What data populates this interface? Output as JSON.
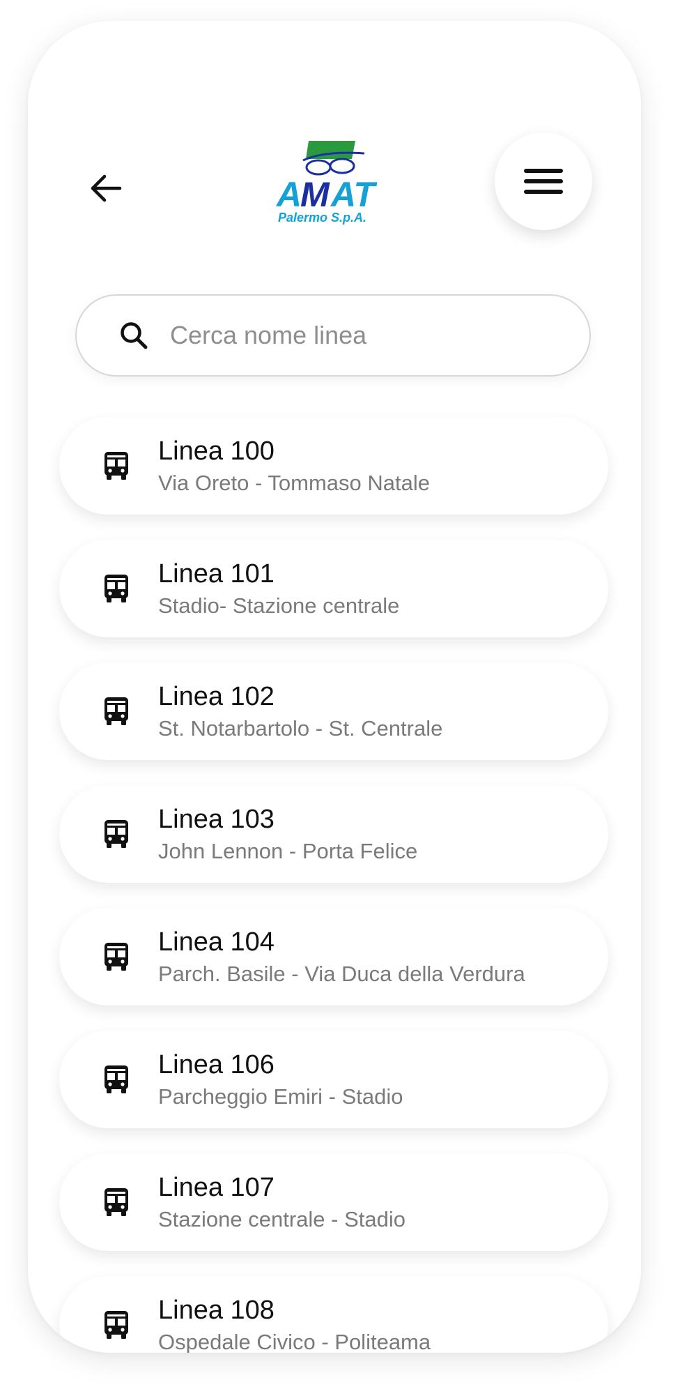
{
  "header": {
    "back_icon": "arrow-left-icon",
    "logo": {
      "brand_text": "AMAT",
      "sub_text": "Palermo S.p.A.",
      "colors": {
        "blue": "#1b2fa3",
        "cyan": "#13a1d6",
        "green": "#2b9a3f"
      }
    },
    "menu_icon": "hamburger-menu-icon"
  },
  "search": {
    "icon": "search-icon",
    "placeholder": "Cerca nome linea",
    "value": ""
  },
  "lines": [
    {
      "title": "Linea 100",
      "route": "Via Oreto - Tommaso Natale",
      "icon": "bus-icon"
    },
    {
      "title": "Linea 101",
      "route": "Stadio- Stazione centrale",
      "icon": "bus-icon"
    },
    {
      "title": "Linea 102",
      "route": "St. Notarbartolo - St. Centrale",
      "icon": "bus-icon"
    },
    {
      "title": "Linea 103",
      "route": "John Lennon - Porta Felice",
      "icon": "bus-icon"
    },
    {
      "title": "Linea 104",
      "route": "Parch. Basile - Via Duca della Verdura",
      "icon": "bus-icon"
    },
    {
      "title": "Linea 106",
      "route": "Parcheggio Emiri - Stadio",
      "icon": "bus-icon"
    },
    {
      "title": "Linea 107",
      "route": "Stazione centrale - Stadio",
      "icon": "bus-icon"
    },
    {
      "title": "Linea 108",
      "route": "Ospedale Civico - Politeama",
      "icon": "bus-icon"
    }
  ]
}
